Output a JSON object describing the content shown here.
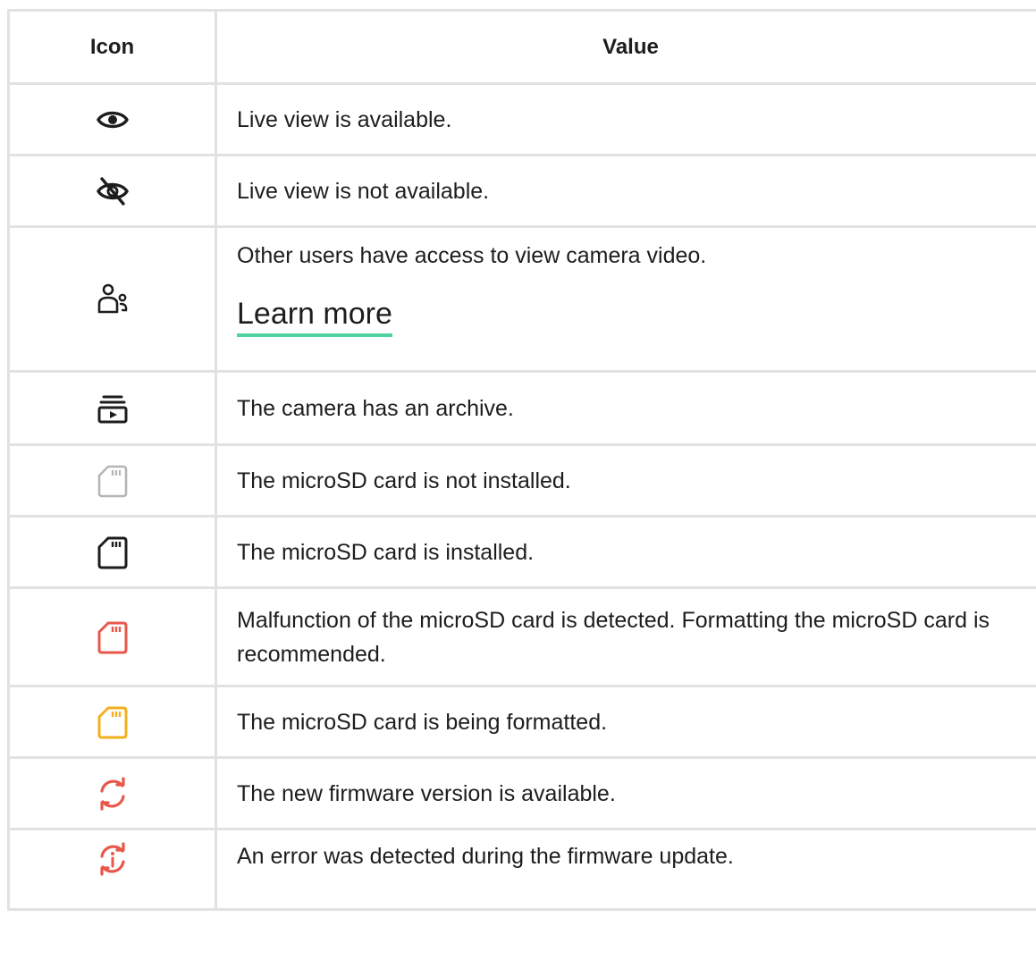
{
  "table": {
    "headers": {
      "icon": "Icon",
      "value": "Value"
    },
    "rows": [
      {
        "icon": "eye-icon",
        "color": "#1d1d1f",
        "value": "Live view is available."
      },
      {
        "icon": "eye-off-icon",
        "color": "#1d1d1f",
        "value": "Live view is not available."
      },
      {
        "icon": "users-icon",
        "color": "#1d1d1f",
        "value": "Other users have access to view camera video.",
        "link": "Learn more"
      },
      {
        "icon": "archive-icon",
        "color": "#1d1d1f",
        "value": "The camera has an archive."
      },
      {
        "icon": "sd-card-icon",
        "color": "#b5b5b5",
        "value": "The microSD card is not installed."
      },
      {
        "icon": "sd-card-icon",
        "color": "#1d1d1f",
        "value": "The microSD card is installed."
      },
      {
        "icon": "sd-card-icon",
        "color": "#e8574c",
        "value": "Malfunction of the microSD card is detected. Formatting the microSD card is recommended."
      },
      {
        "icon": "sd-card-icon",
        "color": "#f2b01e",
        "value": "The microSD card is being formatted."
      },
      {
        "icon": "refresh-icon",
        "color": "#e8574c",
        "value": "The new firmware version is available."
      },
      {
        "icon": "refresh-info-icon",
        "color": "#e8574c",
        "value": "An error was detected during the firmware update."
      }
    ]
  }
}
